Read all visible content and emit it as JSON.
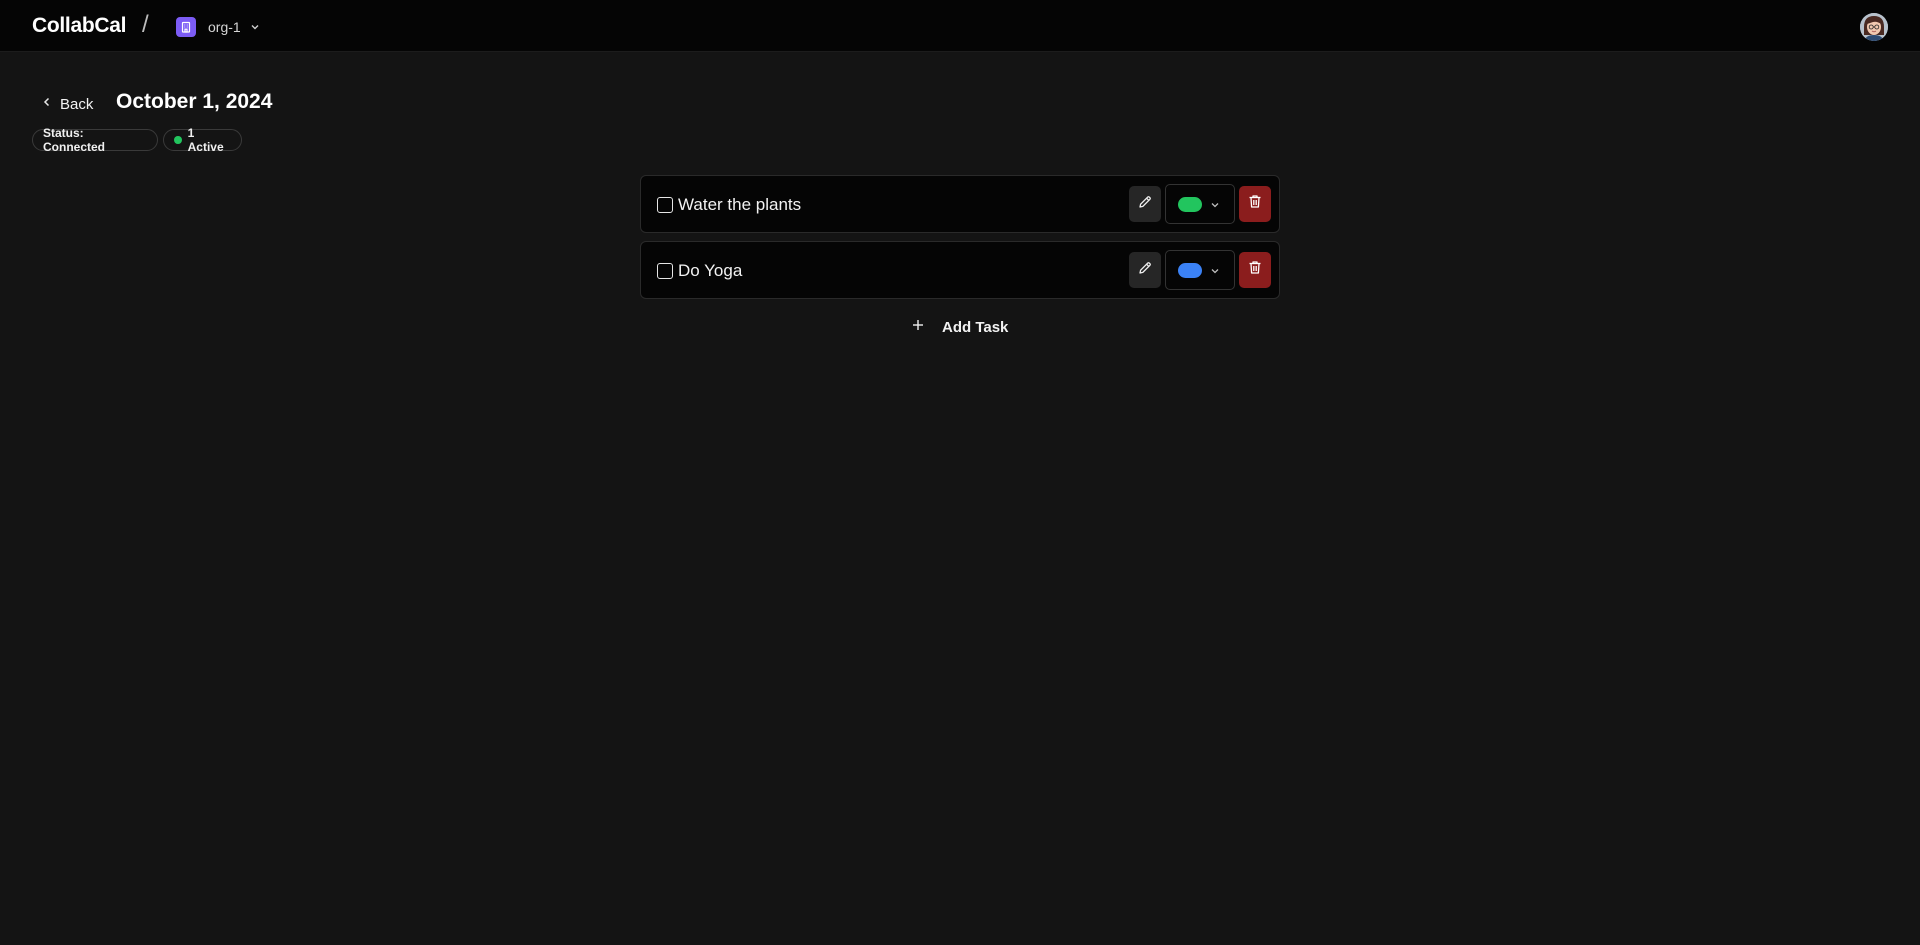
{
  "app": {
    "brand": "CollabCal",
    "separator": "/",
    "org": {
      "name": "org-1",
      "icon": "building-icon",
      "accent": "#7c5cf5"
    }
  },
  "header": {
    "back_label": "Back",
    "title": "October 1, 2024"
  },
  "status": {
    "connection": "Status: Connected",
    "active": "1 Active",
    "active_color": "#22c55e"
  },
  "tasks": [
    {
      "title": "Water the plants",
      "checked": false,
      "color": "#22c55e"
    },
    {
      "title": "Do Yoga",
      "checked": false,
      "color": "#3b82f6"
    }
  ],
  "actions": {
    "add_task_label": "Add Task",
    "delete_color": "#8b1d1d"
  }
}
